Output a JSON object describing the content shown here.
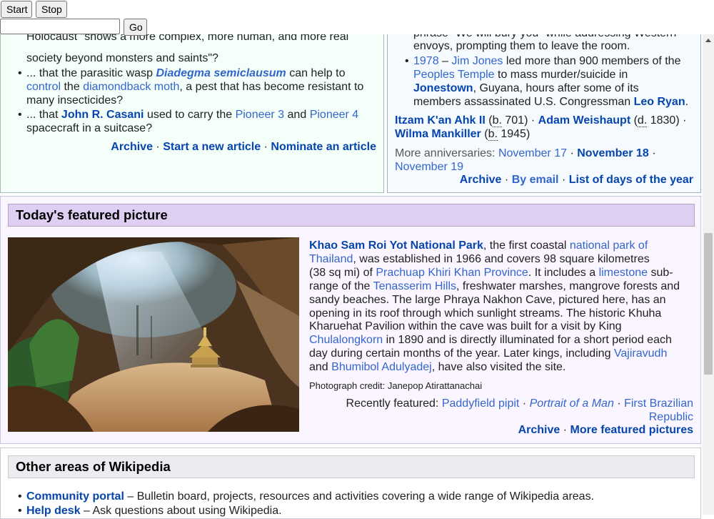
{
  "controls": {
    "start_label": "Start",
    "stop_label": "Stop",
    "go_label": "Go",
    "url_value": ""
  },
  "dyk": {
    "top_partial": "Holocaust \"shows a more complex, more human, and more real",
    "line2": "society beyond monsters and saints\"?",
    "item2": {
      "prefix": "... that the parasitic wasp",
      "wasp": "Diadegma semiclausum",
      "mid": "can help to",
      "control": "control",
      "the": "the",
      "moth": "diamondback moth",
      "rest1": ", a pest that has become resistant to",
      "rest2": "many insecticides?"
    },
    "item3": {
      "prefix": "... that",
      "person": "John R. Casani",
      "mid": "used to carry the",
      "p3": "Pioneer 3",
      "and": "and",
      "p4": "Pioneer 4",
      "rest": "spacecraft in a suitcase?"
    },
    "footer": {
      "archive": "Archive",
      "start_article": "Start a new article",
      "nominate": "Nominate an article"
    }
  },
  "otd": {
    "top_partial": "phrase \"We will bury you\" while addressing Western",
    "line_envoys": "envoys, prompting them to leave the room.",
    "item1978": {
      "year": "1978",
      "dash": "–",
      "jones": "Jim Jones",
      "mid": "led more than 900 members of the",
      "temple": "Peoples Temple",
      "mid2": "to mass murder/suicide in",
      "jonestown": "Jonestown",
      "mid3": ", Guyana, hours after some of its",
      "mid4": "members assassinated U.S. Congressman",
      "ryan": "Leo Ryan",
      "end": "."
    },
    "births": {
      "p1": "Itzam K'an Ahk II",
      "p1_abbr": "b.",
      "p1_year": "701)",
      "p2": "Adam Weishaupt",
      "p2_abbr": "d.",
      "p2_year": "1830)",
      "p3": "Wilma Mankiller",
      "p3_abbr": "b.",
      "p3_year": "1945)"
    },
    "more": {
      "label": "More anniversaries:",
      "d1": "November 17",
      "d2": "November 18",
      "d3": "November 19"
    },
    "footer": {
      "archive": "Archive",
      "email": "By email",
      "days": "List of days of the year"
    }
  },
  "tfp": {
    "heading": "Today's featured picture",
    "park": "Khao Sam Roi Yot National Park",
    "t1": ", the first coastal",
    "l_national": "national park of",
    "l_thailand": "Thailand",
    "t2": ", was established in 1966 and covers 98 square kilometres",
    "t3a": "(38 sq mi) of",
    "l_province": "Prachuap Khiri Khan Province",
    "t3b": ". It includes a",
    "l_limestone": "limestone",
    "t3c": "sub-",
    "t4a": "range of the",
    "l_hills": "Tenasserim Hills",
    "t4b": ", freshwater marshes, mangrove forests and",
    "t5": "sandy beaches. The large Phraya Nakhon Cave, pictured here, has an",
    "t6": "opening in its roof through which sunlight streams. The historic Khuha",
    "t7": "Kharuehat Pavilion within the cave was built for a visit by King",
    "l_chula": "Chulalongkorn",
    "t8": "in 1890 and is directly illuminated for a short period each",
    "t9": "day during certain months of the year. Later kings, including",
    "l_vajira": "Vajiravudh",
    "t10a": "and",
    "l_bhumibol": "Bhumibol Adulyadej",
    "t10b": ", have also visited the site.",
    "credit": "Photograph credit: Janepop Atirattanachai",
    "recent_label": "Recently featured:",
    "r1": "Paddyfield pipit",
    "r2": "Portrait of a Man",
    "r3a": "First Brazilian",
    "r3b": "Republic",
    "archive": "Archive",
    "more": "More featured pictures"
  },
  "other": {
    "heading": "Other areas of Wikipedia",
    "i1_link": "Community portal",
    "i1_text": "– Bulletin board, projects, resources and activities covering a wide range of Wikipedia areas.",
    "i2_link": "Help desk",
    "i2_text": "– Ask questions about using Wikipedia."
  },
  "sep": "·",
  "paren": "("
}
